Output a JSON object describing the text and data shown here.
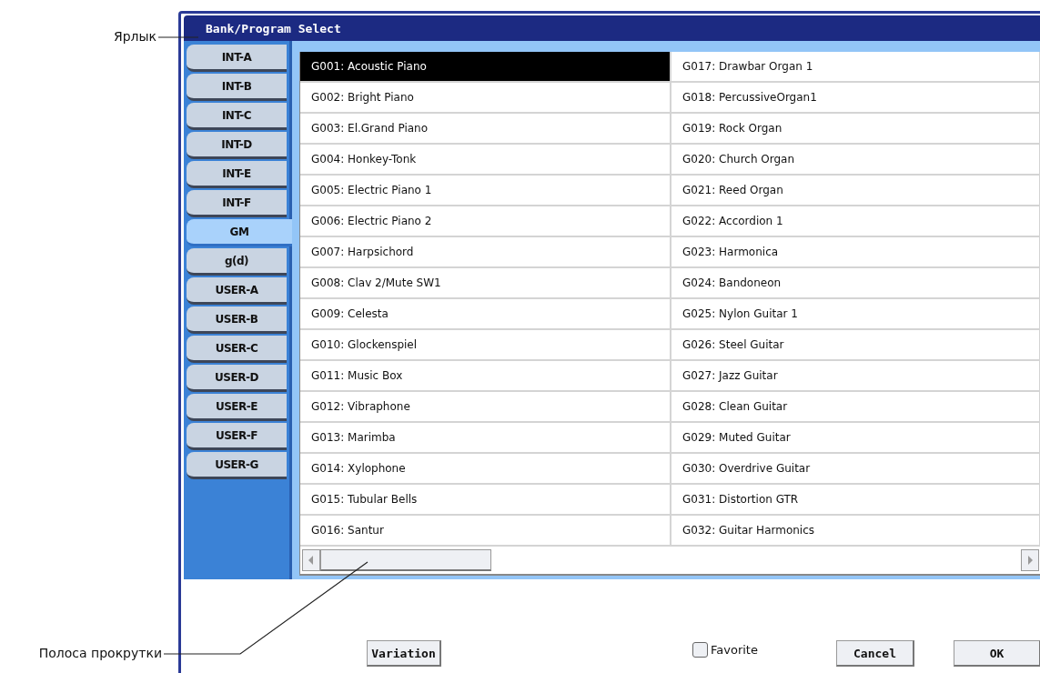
{
  "annotations": [
    {
      "kind": "tab",
      "text": "Ярлык"
    },
    {
      "kind": "scrollbar",
      "text": "Полоса прокрутки"
    }
  ],
  "window": {
    "title": "Bank/Program Select"
  },
  "banks": [
    {
      "label": "INT-A",
      "selected": false
    },
    {
      "label": "INT-B",
      "selected": false
    },
    {
      "label": "INT-C",
      "selected": false
    },
    {
      "label": "INT-D",
      "selected": false
    },
    {
      "label": "INT-E",
      "selected": false
    },
    {
      "label": "INT-F",
      "selected": false
    },
    {
      "label": "GM",
      "selected": true
    },
    {
      "label": "g(d)",
      "selected": false
    },
    {
      "label": "USER-A",
      "selected": false
    },
    {
      "label": "USER-B",
      "selected": false
    },
    {
      "label": "USER-C",
      "selected": false
    },
    {
      "label": "USER-D",
      "selected": false
    },
    {
      "label": "USER-E",
      "selected": false
    },
    {
      "label": "USER-F",
      "selected": false
    },
    {
      "label": "USER-G",
      "selected": false
    }
  ],
  "programs": [
    {
      "label": "G001: Acoustic Piano",
      "selected": true
    },
    {
      "label": "G002: Bright Piano",
      "selected": false
    },
    {
      "label": "G003: El.Grand Piano",
      "selected": false
    },
    {
      "label": "G004: Honkey-Tonk",
      "selected": false
    },
    {
      "label": "G005: Electric Piano 1",
      "selected": false
    },
    {
      "label": "G006: Electric Piano 2",
      "selected": false
    },
    {
      "label": "G007: Harpsichord",
      "selected": false
    },
    {
      "label": "G008: Clav 2/Mute SW1",
      "selected": false
    },
    {
      "label": "G009: Celesta",
      "selected": false
    },
    {
      "label": "G010: Glockenspiel",
      "selected": false
    },
    {
      "label": "G011: Music Box",
      "selected": false
    },
    {
      "label": "G012: Vibraphone",
      "selected": false
    },
    {
      "label": "G013: Marimba",
      "selected": false
    },
    {
      "label": "G014: Xylophone",
      "selected": false
    },
    {
      "label": "G015: Tubular Bells",
      "selected": false
    },
    {
      "label": "G016: Santur",
      "selected": false
    },
    {
      "label": "G017: Drawbar Organ 1",
      "selected": false
    },
    {
      "label": "G018: PercussiveOrgan1",
      "selected": false
    },
    {
      "label": "G019: Rock Organ",
      "selected": false
    },
    {
      "label": "G020: Church Organ",
      "selected": false
    },
    {
      "label": "G021: Reed Organ",
      "selected": false
    },
    {
      "label": "G022: Accordion 1",
      "selected": false
    },
    {
      "label": "G023: Harmonica",
      "selected": false
    },
    {
      "label": "G024: Bandoneon",
      "selected": false
    },
    {
      "label": "G025: Nylon Guitar 1",
      "selected": false
    },
    {
      "label": "G026: Steel Guitar",
      "selected": false
    },
    {
      "label": "G027: Jazz Guitar",
      "selected": false
    },
    {
      "label": "G028: Clean Guitar",
      "selected": false
    },
    {
      "label": "G029: Muted Guitar",
      "selected": false
    },
    {
      "label": "G030: Overdrive Guitar",
      "selected": false
    },
    {
      "label": "G031: Distortion GTR",
      "selected": false
    },
    {
      "label": "G032: Guitar Harmonics",
      "selected": false
    }
  ],
  "variation_button": "Variation",
  "favorite": {
    "label": "Favorite",
    "checked": false
  },
  "buttons": [
    "Cancel",
    "OK"
  ]
}
